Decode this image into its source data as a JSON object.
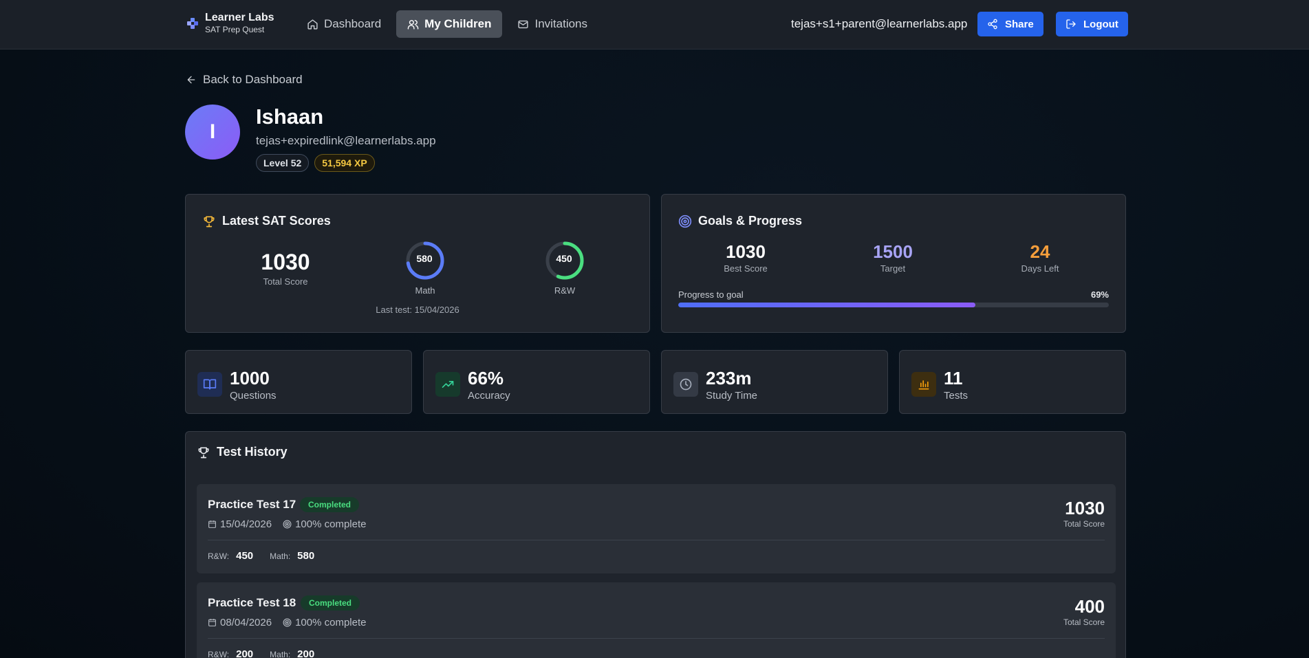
{
  "brand": {
    "name": "Learner Labs",
    "subtitle": "SAT Prep Quest"
  },
  "nav": [
    {
      "label": "Dashboard",
      "icon": "home-icon",
      "active": false
    },
    {
      "label": "My Children",
      "icon": "users-icon",
      "active": true
    },
    {
      "label": "Invitations",
      "icon": "mail-icon",
      "active": false
    }
  ],
  "header": {
    "user_email": "tejas+s1+parent@learnerlabs.app",
    "share_label": "Share",
    "logout_label": "Logout"
  },
  "back_label": "Back to Dashboard",
  "child": {
    "initial": "I",
    "name": "Ishaan",
    "email": "tejas+expiredlink@learnerlabs.app",
    "level": "Level 52",
    "xp": "51,594 XP"
  },
  "sat": {
    "title": "Latest SAT Scores",
    "total": "1030",
    "total_label": "Total Score",
    "math": {
      "value": "580",
      "label": "Math",
      "fraction": 0.725
    },
    "rw": {
      "value": "450",
      "label": "R&W",
      "fraction": 0.5625
    },
    "last_test": "Last test: 15/04/2026"
  },
  "goals": {
    "title": "Goals & Progress",
    "best_score": "1030",
    "best_score_label": "Best Score",
    "target": "1500",
    "target_label": "Target",
    "days_left": "24",
    "days_left_label": "Days Left",
    "progress_label": "Progress to goal",
    "progress_pct": "69%",
    "progress_fraction": 0.69
  },
  "stats": [
    {
      "value": "1000",
      "label": "Questions",
      "icon": "book-icon",
      "color": "#5b7cf7"
    },
    {
      "value": "66%",
      "label": "Accuracy",
      "icon": "trending-up-icon",
      "color": "#34d399"
    },
    {
      "value": "233m",
      "label": "Study Time",
      "icon": "clock-icon",
      "color": "#a5adbb"
    },
    {
      "value": "11",
      "label": "Tests",
      "icon": "bar-chart-icon",
      "color": "#f59e0b"
    }
  ],
  "history": {
    "title": "Test History",
    "tests": [
      {
        "name": "Practice Test 17",
        "status": "Completed",
        "date": "15/04/2026",
        "completion": "100% complete",
        "rw_label": "R&W:",
        "rw": "450",
        "math_label": "Math:",
        "math": "580",
        "total": "1030",
        "total_label": "Total Score"
      },
      {
        "name": "Practice Test 18",
        "status": "Completed",
        "date": "08/04/2026",
        "completion": "100% complete",
        "rw_label": "R&W:",
        "rw": "200",
        "math_label": "Math:",
        "math": "200",
        "total": "400",
        "total_label": "Total Score"
      }
    ]
  },
  "colors": {
    "accent": "#2563eb",
    "target": "#a8a4f5",
    "days_left": "#f59e3b",
    "completed": "#4ade80"
  }
}
